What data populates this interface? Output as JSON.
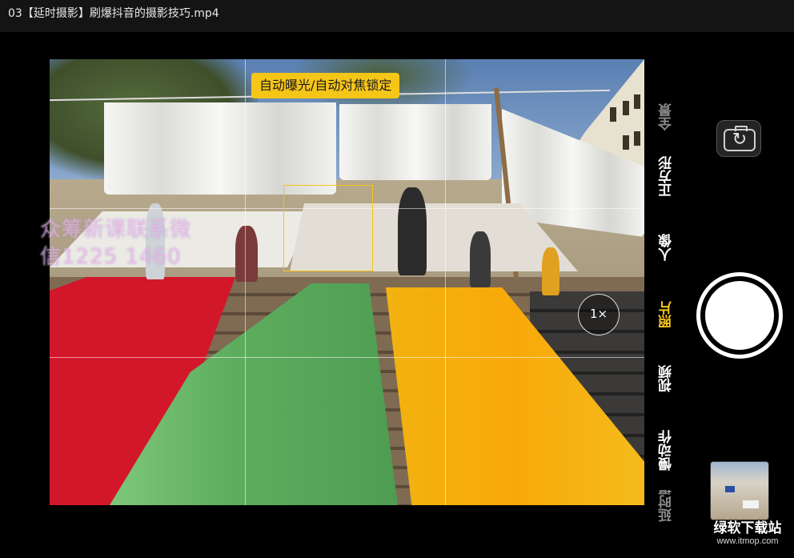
{
  "video": {
    "title": "03【延时摄影】刷爆抖音的摄影技巧.mp4"
  },
  "viewfinder": {
    "ae_af_lock_label": "自动曝光/自动对焦锁定",
    "zoom_label": "1×",
    "watermark_line1": "众筹新课联系微",
    "watermark_line2": "信1225 1460"
  },
  "camera_modes": [
    {
      "label": "全景",
      "state": "dim"
    },
    {
      "label": "正方形",
      "state": "normal"
    },
    {
      "label": "人像",
      "state": "normal"
    },
    {
      "label": "照片",
      "state": "active"
    },
    {
      "label": "视频",
      "state": "normal"
    },
    {
      "label": "慢动作",
      "state": "normal"
    },
    {
      "label": "延时摄影",
      "state": "dim"
    }
  ],
  "colors": {
    "accent": "#f5c518",
    "background": "#000000"
  },
  "icons": {
    "switch_camera": "switch-camera-icon",
    "shutter": "shutter-button"
  },
  "brand": {
    "name": "绿软下载站",
    "url": "www.itmop.com"
  }
}
